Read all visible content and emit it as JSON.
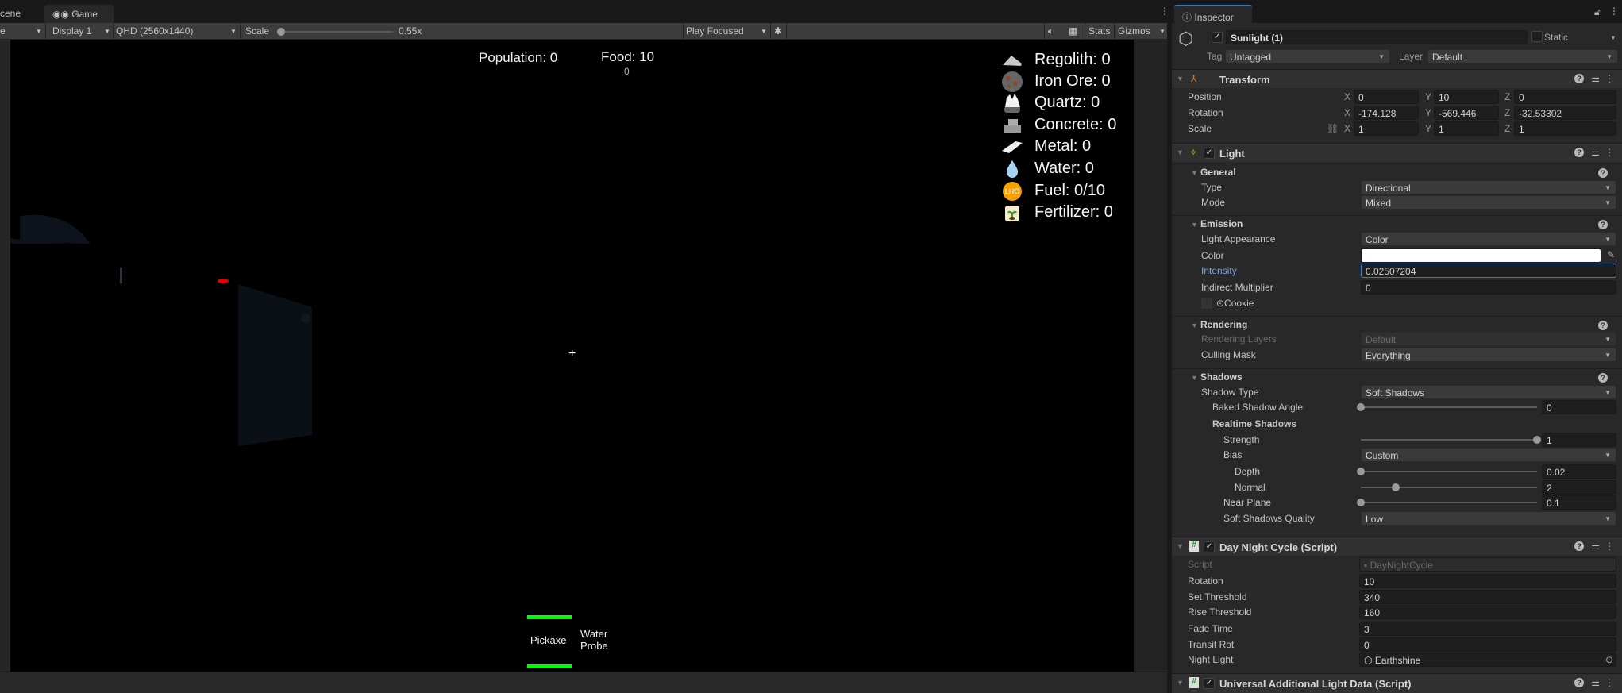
{
  "tabs": {
    "scene_partial": "cene",
    "game": "Game",
    "game_icon": "gamepad-icon"
  },
  "toolbar": {
    "left_partial": "e",
    "display": "Display 1",
    "resolution": "QHD (2560x1440)",
    "scale_label": "Scale",
    "scale_value": "0.55x",
    "scale_fraction": 0.0,
    "play_mode": "Play Focused",
    "stats": "Stats",
    "gizmos": "Gizmos"
  },
  "hud": {
    "population": "Population: 0",
    "food": "Food: 10",
    "food_delta": "0",
    "food_delta_color": "#8fd18a",
    "resources": [
      {
        "icon": "regolith-icon",
        "label": "Regolith: 0"
      },
      {
        "icon": "iron-ore-icon",
        "label": "Iron Ore: 0"
      },
      {
        "icon": "quartz-icon",
        "label": "Quartz: 0"
      },
      {
        "icon": "concrete-icon",
        "label": "Concrete: 0"
      },
      {
        "icon": "metal-icon",
        "label": "Metal: 0"
      },
      {
        "icon": "water-icon",
        "label": "Water: 0"
      },
      {
        "icon": "fuel-icon",
        "label": "Fuel: 0/10",
        "icon_text": "LHO"
      },
      {
        "icon": "fertilizer-icon",
        "label": "Fertilizer: 0"
      }
    ],
    "crosshair": "+",
    "tools": [
      {
        "label": "Pickaxe",
        "selected": true
      },
      {
        "label": "Water Probe",
        "selected": false
      }
    ],
    "selected_color": "#00ff00"
  },
  "inspector": {
    "tab": "Inspector",
    "object_name": "Sunlight (1)",
    "static_label": "Static",
    "tag_label": "Tag",
    "tag": "Untagged",
    "layer_label": "Layer",
    "layer": "Default",
    "transform": {
      "title": "Transform",
      "position": {
        "label": "Position",
        "x": "0",
        "y": "10",
        "z": "0"
      },
      "rotation": {
        "label": "Rotation",
        "x": "-174.128",
        "y": "-569.446",
        "z": "-32.53302"
      },
      "scale": {
        "label": "Scale",
        "x": "1",
        "y": "1",
        "z": "1"
      }
    },
    "light": {
      "title": "Light",
      "general": "General",
      "type_label": "Type",
      "type": "Directional",
      "mode_label": "Mode",
      "mode": "Mixed",
      "emission": "Emission",
      "appearance_label": "Light Appearance",
      "appearance": "Color",
      "color_label": "Color",
      "color": "#ffffff",
      "intensity_label": "Intensity",
      "intensity": "0.02507204",
      "indirect_label": "Indirect Multiplier",
      "indirect": "0",
      "cookie_label": "⊙Cookie",
      "rendering": "Rendering",
      "layers_label": "Rendering Layers",
      "layers": "Default",
      "culling_label": "Culling Mask",
      "culling": "Everything",
      "shadows": "Shadows",
      "shadow_type_label": "Shadow Type",
      "shadow_type": "Soft Shadows",
      "baked_label": "Baked Shadow Angle",
      "baked": "0",
      "baked_pos": 0,
      "realtime": "Realtime Shadows",
      "strength_label": "Strength",
      "strength": "1",
      "strength_pos": 1,
      "bias_label": "Bias",
      "bias": "Custom",
      "depth_label": "Depth",
      "depth": "0.02",
      "depth_pos": 0.0,
      "normal_label": "Normal",
      "normal": "2",
      "normal_pos": 0.2,
      "near_label": "Near Plane",
      "near": "0.1",
      "near_pos": 0.0,
      "quality_label": "Soft Shadows Quality",
      "quality": "Low"
    },
    "daynight": {
      "title": "Day Night Cycle (Script)",
      "script_label": "Script",
      "script": "DayNightCycle",
      "rotation_label": "Rotation",
      "rotation": "10",
      "set_label": "Set Threshold",
      "set": "340",
      "rise_label": "Rise Threshold",
      "rise": "160",
      "fade_label": "Fade Time",
      "fade": "3",
      "transit_label": "Transit Rot",
      "transit": "0",
      "night_label": "Night Light",
      "night": "Earthshine"
    },
    "uald": {
      "title": "Universal Additional Light Data (Script)"
    }
  }
}
